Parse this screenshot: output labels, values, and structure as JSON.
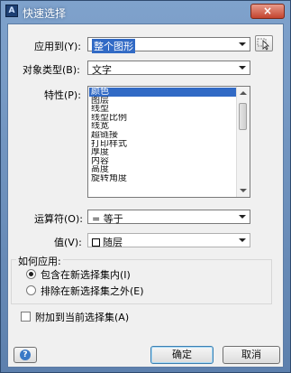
{
  "window": {
    "title": "快速选择",
    "close_glyph": "×",
    "app_icon_glyph": "A"
  },
  "apply_to": {
    "label": "应用到(Y):",
    "value": "整个图形"
  },
  "object_type": {
    "label": "对象类型(B):",
    "value": "文字"
  },
  "properties": {
    "label": "特性(P):",
    "items": [
      "颜色",
      "图层",
      "线型",
      "线型比例",
      "线宽",
      "超链接",
      "打印样式",
      "厚度",
      "内容",
      "高度",
      "旋转角度"
    ],
    "selected_index": 0
  },
  "operator": {
    "label": "运算符(O):",
    "value": "= 等于"
  },
  "value": {
    "label": "值(V):",
    "value": "随层"
  },
  "how_to_apply": {
    "label": "如何应用:",
    "options": [
      "包含在新选择集内(I)",
      "排除在新选择集之外(E)"
    ],
    "selected_index": 0
  },
  "append": {
    "label": "附加到当前选择集(A)",
    "checked": false
  },
  "buttons": {
    "ok": "确定",
    "cancel": "取消",
    "help_glyph": "?"
  },
  "icons": {
    "app": "autocad-icon",
    "pick": "select-objects-icon",
    "help": "help-icon"
  },
  "colors": {
    "selection": "#316ac5",
    "title_bar": "#6f8fb8",
    "close": "#c4442f"
  }
}
